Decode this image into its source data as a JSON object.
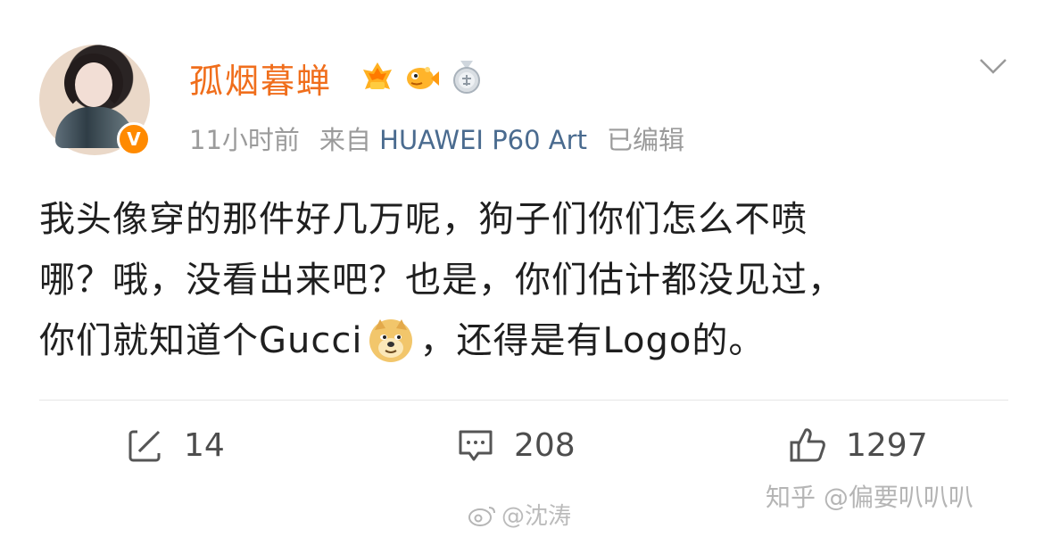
{
  "post": {
    "author": {
      "name": "孤烟暮蝉",
      "badges": [
        "gold-rank-badge-icon",
        "fish-badge-icon",
        "medal-badge-icon"
      ],
      "verified_mark": "V"
    },
    "meta": {
      "time": "11小时前",
      "source_prefix": "来自",
      "device": "HUAWEI P60 Art",
      "edited": "已编辑"
    },
    "content": {
      "line1": "我头像穿的那件好几万呢，狗子们你们怎么不喷",
      "line2": "哪？哦，没看出来吧？也是，你们估计都没见过，",
      "line3_before": "你们就知道个Gucci",
      "emoji": "doge-emoji-icon",
      "line3_after": "，还得是有Logo的。"
    },
    "actions": {
      "repost_count": "14",
      "comment_count": "208",
      "like_count": "1297"
    }
  },
  "watermarks": {
    "zhihu": "知乎 @偏要叭叭叭",
    "weibo": "@沈涛"
  },
  "colors": {
    "username": "#f06e1c",
    "device_link": "#4a6b8f",
    "meta_gray": "#9b9b9b",
    "verified_badge": "#ff8a00"
  }
}
